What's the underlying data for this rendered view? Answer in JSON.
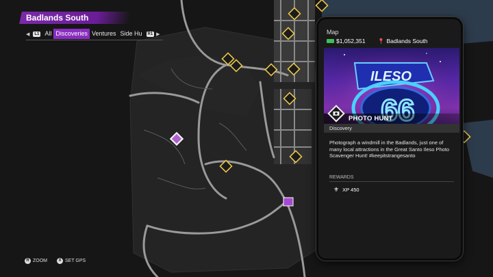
{
  "region": {
    "title": "Badlands South"
  },
  "filters": {
    "left_button": "L1",
    "right_button": "R1",
    "tabs": [
      {
        "label": "All",
        "active": false
      },
      {
        "label": "Discoveries",
        "active": true
      },
      {
        "label": "Ventures",
        "active": false
      },
      {
        "label": "Side Hu",
        "active": false
      }
    ]
  },
  "hints": {
    "zoom": {
      "button": "R",
      "label": "ZOOM"
    },
    "gps": {
      "button": "X",
      "label": "SET GPS"
    }
  },
  "phone": {
    "header": "Map",
    "cash": "$1,052,351",
    "location": "Badlands South",
    "mission": {
      "title": "PHOTO HUNT",
      "category": "Discovery",
      "description": "Photograph a windmill in the Badlands, just one of many local attractions in the Great Santo Ileso Photo Scavenger Hunt! #keepitstrangesanto",
      "rewards_label": "REWARDS",
      "reward": "XP 450",
      "hero_sign_text": "ILESO",
      "hero_sign_number": "66"
    }
  },
  "colors": {
    "accent_purple": "#8a2cc0",
    "marker_gold": "#e8c64a",
    "cash_green": "#3fbf5a"
  }
}
